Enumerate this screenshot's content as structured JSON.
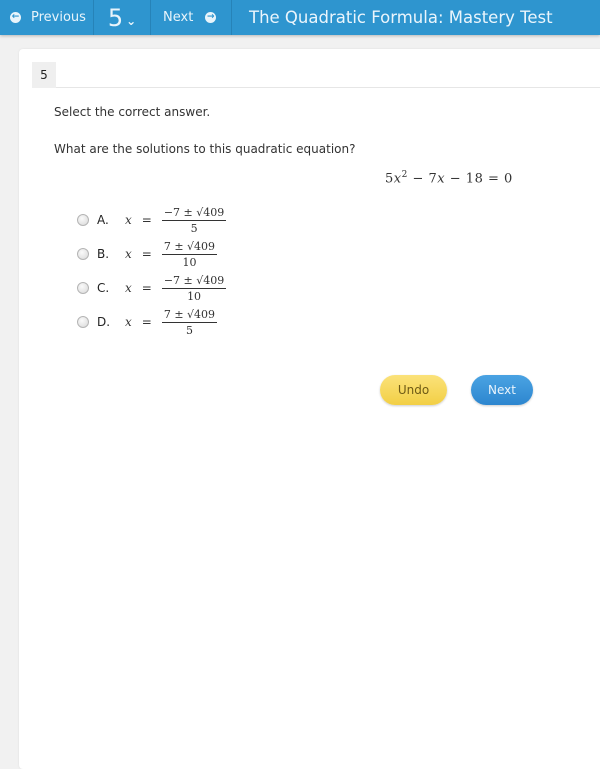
{
  "topbar": {
    "previous_label": "Previous",
    "question_number": "5",
    "next_label": "Next",
    "title": "The Quadratic Formula: Mastery Test",
    "prev_icon": "←",
    "next_icon": "→",
    "dropdown_icon": "⌄"
  },
  "question": {
    "number": "5",
    "instruction": "Select the correct answer.",
    "prompt": "What are the solutions to this quadratic equation?",
    "equation": {
      "coef_a": "5",
      "var": "x",
      "exp": "2",
      "rest": " − 7",
      "var2": "x",
      "tail": " − 18 = 0"
    },
    "options": [
      {
        "letter": "A.",
        "var": "x",
        "eq": "=",
        "numerator": "−7 ± √409",
        "denominator": "5"
      },
      {
        "letter": "B.",
        "var": "x",
        "eq": "=",
        "numerator": "7 ± √409",
        "denominator": "10"
      },
      {
        "letter": "C.",
        "var": "x",
        "eq": "=",
        "numerator": "−7 ± √409",
        "denominator": "10"
      },
      {
        "letter": "D.",
        "var": "x",
        "eq": "=",
        "numerator": "7 ± √409",
        "denominator": "5"
      }
    ]
  },
  "buttons": {
    "undo_label": "Undo",
    "next_label": "Next"
  },
  "colors": {
    "topbar": "#2e95cf",
    "undo": "#f2cf45",
    "next": "#2d86cf"
  }
}
